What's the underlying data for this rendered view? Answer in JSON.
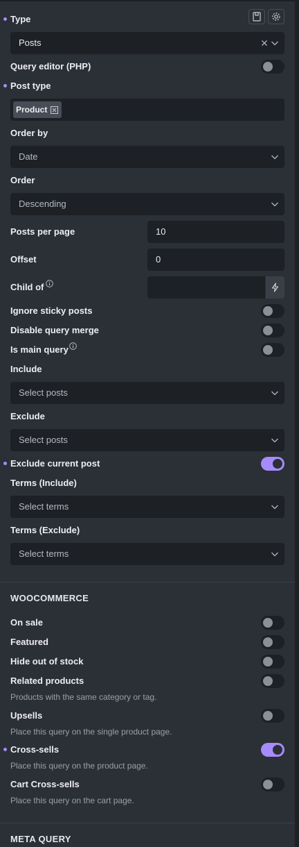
{
  "header": {
    "type_label": "Type"
  },
  "fields": {
    "type": {
      "value": "Posts"
    },
    "query_editor": {
      "label": "Query editor (PHP)",
      "on": false
    },
    "post_type": {
      "label": "Post type",
      "tag": "Product"
    },
    "order_by": {
      "label": "Order by",
      "value": "Date"
    },
    "order": {
      "label": "Order",
      "value": "Descending"
    },
    "posts_per_page": {
      "label": "Posts per page",
      "value": "10"
    },
    "offset": {
      "label": "Offset",
      "value": "0"
    },
    "child_of": {
      "label": "Child of",
      "value": ""
    },
    "ignore_sticky": {
      "label": "Ignore sticky posts",
      "on": false
    },
    "disable_merge": {
      "label": "Disable query merge",
      "on": false
    },
    "main_query": {
      "label": "Is main query",
      "on": false
    },
    "include": {
      "label": "Include",
      "placeholder": "Select posts"
    },
    "exclude": {
      "label": "Exclude",
      "placeholder": "Select posts"
    },
    "exclude_current": {
      "label": "Exclude current post",
      "on": true
    },
    "terms_include": {
      "label": "Terms (Include)",
      "placeholder": "Select terms"
    },
    "terms_exclude": {
      "label": "Terms (Exclude)",
      "placeholder": "Select terms"
    }
  },
  "woocommerce": {
    "title": "WOOCOMMERCE",
    "on_sale": {
      "label": "On sale",
      "on": false
    },
    "featured": {
      "label": "Featured",
      "on": false
    },
    "hide_out_of_stock": {
      "label": "Hide out of stock",
      "on": false
    },
    "related": {
      "label": "Related products",
      "desc": "Products with the same category or tag.",
      "on": false
    },
    "upsells": {
      "label": "Upsells",
      "desc": "Place this query on the single product page.",
      "on": false
    },
    "cross_sells": {
      "label": "Cross-sells",
      "desc": "Place this query on the product page.",
      "on": true
    },
    "cart_cross_sells": {
      "label": "Cart Cross-sells",
      "desc": "Place this query on the cart page.",
      "on": false
    }
  },
  "meta_query": {
    "title": "META QUERY"
  },
  "icons": {
    "save": "save-template-icon",
    "settings": "gear-icon",
    "clear": "close-icon",
    "dropdown": "chevron-down-icon",
    "dynamic": "bolt-icon",
    "info": "info-icon",
    "tag_remove": "tag-remove-icon"
  },
  "colors": {
    "accent": "#a78bfa",
    "panel": "#2b2f36",
    "input": "#1d2025"
  }
}
